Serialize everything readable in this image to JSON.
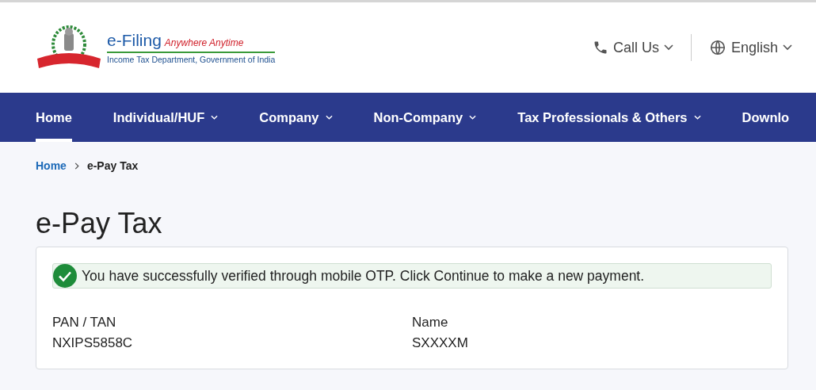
{
  "logo": {
    "title": "e-Filing",
    "tagline": "Anywhere Anytime",
    "subtitle": "Income Tax Department, Government of India"
  },
  "header_actions": {
    "call": "Call Us",
    "language": "English"
  },
  "nav": [
    {
      "label": "Home",
      "selected": true,
      "has_menu": false
    },
    {
      "label": "Individual/HUF",
      "selected": false,
      "has_menu": true
    },
    {
      "label": "Company",
      "selected": false,
      "has_menu": true
    },
    {
      "label": "Non-Company",
      "selected": false,
      "has_menu": true
    },
    {
      "label": "Tax Professionals & Others",
      "selected": false,
      "has_menu": true
    },
    {
      "label": "Downlo",
      "selected": false,
      "has_menu": false
    }
  ],
  "breadcrumb": [
    "Home",
    "e-Pay Tax"
  ],
  "page_title": "e-Pay Tax",
  "alert": "You have successfully verified through mobile OTP. Click Continue to make a new payment.",
  "fields": [
    {
      "label": "PAN / TAN",
      "value": "NXIPS5858C"
    },
    {
      "label": "Name",
      "value": "SXXXXM"
    }
  ]
}
